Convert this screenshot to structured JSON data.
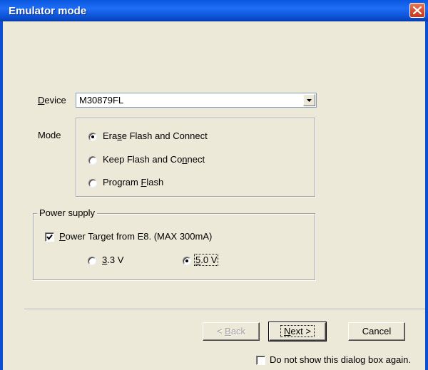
{
  "window": {
    "title": "Emulator mode"
  },
  "device": {
    "label_prefix": "",
    "label_underline": "D",
    "label_rest": "evice",
    "value": "M30879FL"
  },
  "mode": {
    "label": "Mode",
    "options": [
      {
        "pre": "Era",
        "u": "s",
        "post": "e Flash and Connect",
        "selected": true
      },
      {
        "pre": "Keep Flash and Co",
        "u": "n",
        "post": "nect",
        "selected": false
      },
      {
        "pre": "Program ",
        "u": "F",
        "post": "lash",
        "selected": false
      }
    ]
  },
  "power_supply": {
    "legend": "Power supply",
    "checkbox": {
      "pre": "",
      "u": "P",
      "post": "ower Target from E8. (MAX 300mA)",
      "checked": true
    },
    "voltages": [
      {
        "pre": "",
        "u": "3",
        "post": ".3 V",
        "selected": false
      },
      {
        "pre": "",
        "u": "5",
        "post": ".0 V",
        "selected": true
      }
    ]
  },
  "buttons": {
    "back": {
      "pre": "< ",
      "u": "B",
      "post": "ack",
      "enabled": false
    },
    "next": {
      "pre": "",
      "u": "N",
      "post": "ext >",
      "default": true
    },
    "cancel": {
      "label": "Cancel"
    }
  },
  "footer": {
    "dont_show_label": "Do not show this dialog box again.",
    "checked": false
  }
}
